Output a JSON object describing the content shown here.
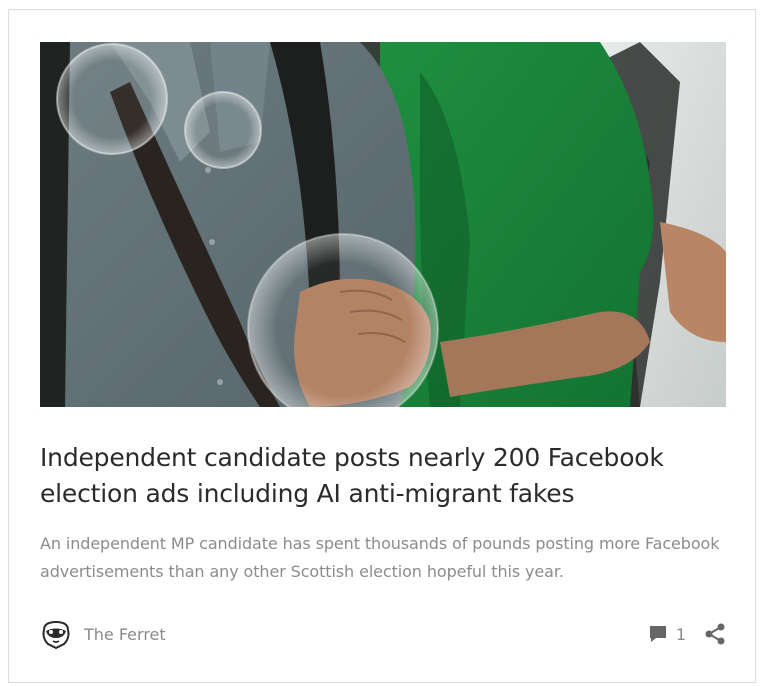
{
  "article": {
    "image_alt": "Two students walking arm in arm",
    "title": "Independent candidate posts nearly 200 Facebook election ads including AI anti-migrant fakes",
    "excerpt": "An independent MP candidate has spent thousands of pounds posting more Facebook advertisements than any other Scottish election hopeful this year."
  },
  "footer": {
    "author_name": "The Ferret",
    "author_logo_icon": "ferret-logo-icon",
    "comment_icon": "comment-bubble-icon",
    "comment_count": "1",
    "share_icon": "share-icon"
  },
  "colors": {
    "title": "#2b2b2b",
    "excerpt": "#8c8c8c",
    "meta": "#8a8a8a",
    "icon": "#666666",
    "border": "#dcdcdc"
  }
}
